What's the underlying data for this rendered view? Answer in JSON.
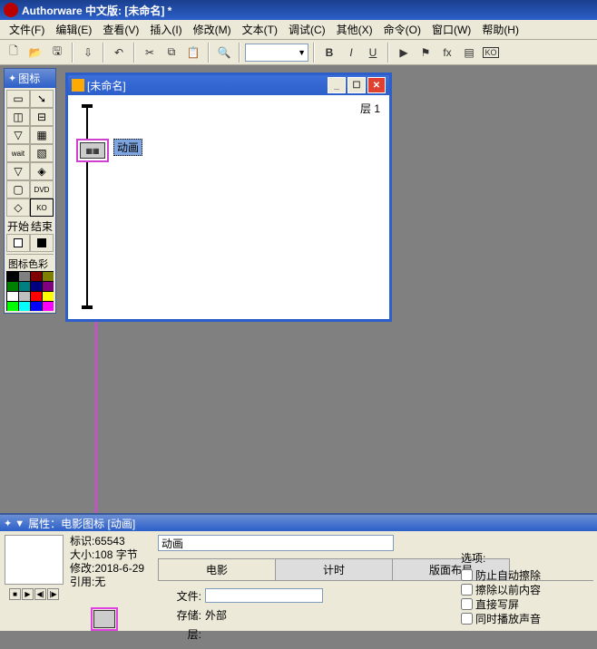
{
  "app_title": "Authorware 中文版: [未命名] *",
  "menu": [
    "文件(F)",
    "编辑(E)",
    "查看(V)",
    "插入(I)",
    "修改(M)",
    "文本(T)",
    "调试(C)",
    "其他(X)",
    "命令(O)",
    "窗口(W)",
    "帮助(H)"
  ],
  "toolbar": {
    "combo_value": "",
    "bold": "B",
    "italic": "I",
    "underline": "U",
    "ko": "KO"
  },
  "tool_panel": {
    "title": "图标",
    "start": "开始",
    "end": "结束",
    "color_title": "图标色彩",
    "colors": [
      "#000000",
      "#808080",
      "#800000",
      "#808000",
      "#008000",
      "#008080",
      "#000080",
      "#800080",
      "#ffffff",
      "#c0c0c0",
      "#ff0000",
      "#ffff00",
      "#00ff00",
      "#00ffff",
      "#0000ff",
      "#ff00ff"
    ]
  },
  "inner_window": {
    "title": "[未命名]",
    "layer_label": "层  1",
    "movie_node_label": "动画"
  },
  "prop": {
    "title": "属性：电影图标  [动画]",
    "info": {
      "id_lbl": "标识:",
      "id": "65543",
      "size_lbl": "大小:",
      "size": "108 字节",
      "mod_lbl": "修改:",
      "mod": "2018-6-29",
      "ref_lbl": "引用:",
      "ref": "无"
    },
    "name": "动画",
    "tabs": [
      "电影",
      "计时",
      "版面布局"
    ],
    "file_lbl": "文件:",
    "file_val": "",
    "store_lbl": "存储:",
    "store_val": "外部",
    "layer_lbl": "层:",
    "opts_lbl": "选项:",
    "opts": [
      "防止自动擦除",
      "擦除以前内容",
      "直接写屏",
      "同时播放声音"
    ]
  }
}
